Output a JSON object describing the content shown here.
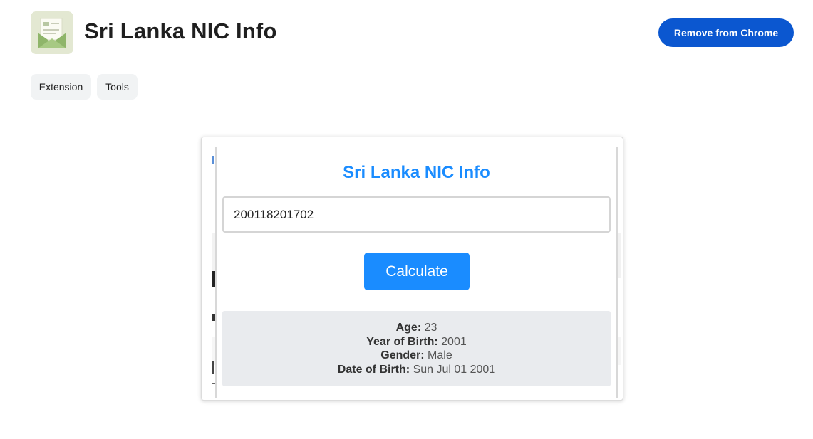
{
  "header": {
    "title": "Sri Lanka NIC Info",
    "remove_button": "Remove from Chrome"
  },
  "chips": [
    "Extension",
    "Tools"
  ],
  "popup": {
    "title": "Sri Lanka NIC Info",
    "nic_value": "200118201702",
    "calculate_label": "Calculate",
    "results": [
      {
        "label": "Age:",
        "value": "23"
      },
      {
        "label": "Year of Birth:",
        "value": "2001"
      },
      {
        "label": "Gender:",
        "value": "Male"
      },
      {
        "label": "Date of Birth:",
        "value": "Sun Jul 01 2001"
      }
    ]
  },
  "colors": {
    "accent": "#0b57d0",
    "popup_accent": "#1a8cff",
    "chip_bg": "#f1f3f4",
    "result_bg": "#e9ebee"
  },
  "icons": {
    "app_icon": "envelope-document-icon"
  }
}
